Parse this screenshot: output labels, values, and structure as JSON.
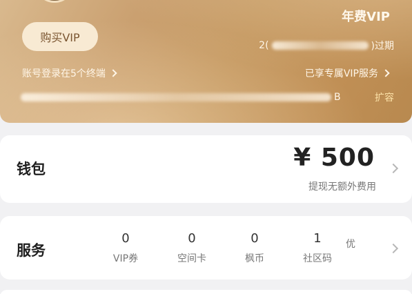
{
  "vip_card": {
    "tier": "年费VIP",
    "buy_button": "购买VIP",
    "expiry_prefix": "2(",
    "expiry_suffix": ")过期",
    "login_info": "账号登录在5个终端",
    "service_link": "已享专属VIP服务",
    "storage_tail": "B",
    "expand_link": "扩容"
  },
  "wallet": {
    "title": "钱包",
    "amount": "¥ 500",
    "note": "提现无额外费用"
  },
  "services": {
    "title": "服务",
    "items": [
      {
        "count": "0",
        "label": "VIP券"
      },
      {
        "count": "0",
        "label": "空间卡"
      },
      {
        "count": "0",
        "label": "枫币"
      },
      {
        "count": "1",
        "label": "社区码"
      },
      {
        "count": "",
        "label": "优"
      }
    ]
  }
}
